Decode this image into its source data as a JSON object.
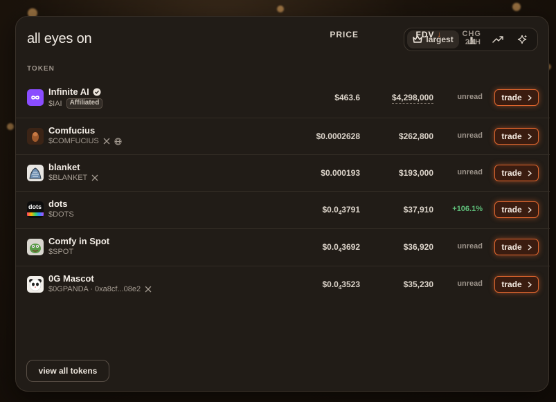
{
  "header": {
    "title": "all eyes on"
  },
  "sort_tabs": {
    "active_label": "largest",
    "icons": [
      "crown-icon",
      "bar-chart-icon",
      "trending-up-icon",
      "sparkle-icon"
    ]
  },
  "columns": {
    "token": "TOKEN",
    "price": "PRICE",
    "fdv": "FDV",
    "chg": "CHG 24H"
  },
  "tokens": [
    {
      "name": "Infinite AI",
      "symbol": "$IAI",
      "badge": "Affiliated",
      "verified": true,
      "price_pre": "$463.6",
      "price_sub": "",
      "price_post": "",
      "fdv": "$4,298,000",
      "chg": "unread",
      "trade": "trade"
    },
    {
      "name": "Comfucius",
      "symbol": "$COMFUCIUS",
      "price_pre": "$0.0002628",
      "price_sub": "",
      "price_post": "",
      "fdv": "$262,800",
      "chg": "unread",
      "trade": "trade"
    },
    {
      "name": "blanket",
      "symbol": "$BLANKET",
      "price_pre": "$0.000193",
      "price_sub": "",
      "price_post": "",
      "fdv": "$193,000",
      "chg": "unread",
      "trade": "trade"
    },
    {
      "name": "dots",
      "symbol": "$DOTS",
      "price_pre": "$0.0",
      "price_sub": "4",
      "price_post": "3791",
      "fdv": "$37,910",
      "chg": "+106.1%",
      "trade": "trade"
    },
    {
      "name": "Comfy in Spot",
      "symbol": "$SPOT",
      "price_pre": "$0.0",
      "price_sub": "4",
      "price_post": "3692",
      "fdv": "$36,920",
      "chg": "unread",
      "trade": "trade"
    },
    {
      "name": "0G Mascot",
      "symbol": "$0GPANDA · 0xa8cf...08e2",
      "price_pre": "$0.0",
      "price_sub": "4",
      "price_post": "3523",
      "fdv": "$35,230",
      "chg": "unread",
      "trade": "trade"
    }
  ],
  "logos": {
    "dots_text": "dots"
  },
  "footer": {
    "view_all": "view all tokens"
  },
  "colors": {
    "accent": "#e0662e",
    "positive": "#5fbf7a",
    "card_bg": "#211c17"
  }
}
